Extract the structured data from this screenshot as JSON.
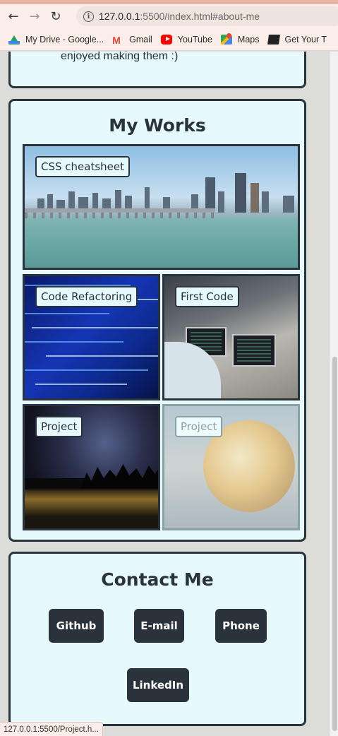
{
  "browser": {
    "url_host": "127.0.0.1",
    "url_rest": ":5500/index.html#about-me",
    "bookmarks": [
      {
        "label": "My Drive - Google...",
        "icon": "google-drive-icon"
      },
      {
        "label": "Gmail",
        "icon": "gmail-icon"
      },
      {
        "label": "YouTube",
        "icon": "youtube-icon"
      },
      {
        "label": "Maps",
        "icon": "maps-icon"
      },
      {
        "label": "Get Your T",
        "icon": "book-icon"
      }
    ],
    "status_url": "127.0.0.1:5500/Project.h..."
  },
  "about": {
    "text_tail": "enjoyed making them :)"
  },
  "works": {
    "title": "My Works",
    "tiles": [
      {
        "label": "CSS cheatsheet"
      },
      {
        "label": "Code Refactoring"
      },
      {
        "label": "First Code"
      },
      {
        "label": "Project"
      },
      {
        "label": "Project"
      }
    ]
  },
  "contact": {
    "title": "Contact Me",
    "buttons": {
      "github": "Github",
      "email": "E-mail",
      "phone": "Phone",
      "linkedin": "LinkedIn"
    }
  },
  "colors": {
    "card_bg": "#e6fafc",
    "dark": "#2a323b",
    "page_bg": "#dcdcd8"
  }
}
